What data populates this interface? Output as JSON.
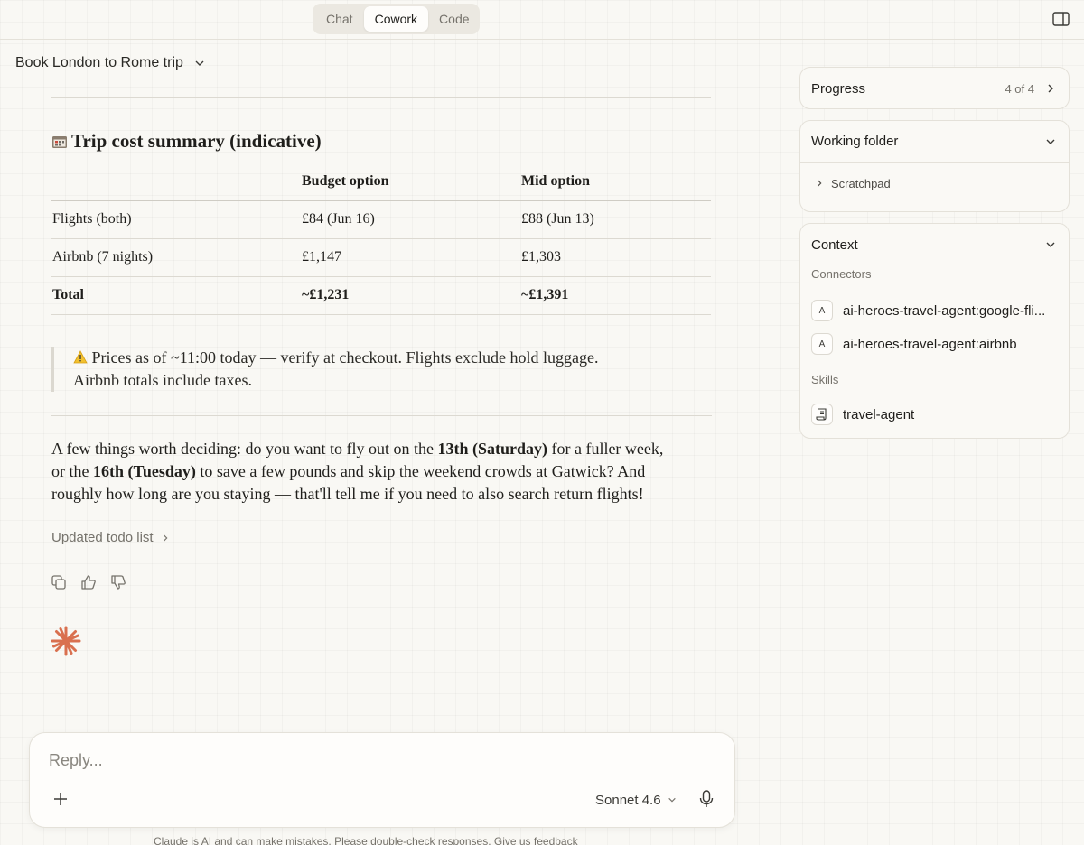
{
  "tabs": [
    {
      "label": "Chat",
      "active": false
    },
    {
      "label": "Cowork",
      "active": true
    },
    {
      "label": "Code",
      "active": false
    }
  ],
  "conversation": {
    "title": "Book London to Rome trip"
  },
  "summary": {
    "title": "Trip cost summary (indicative)",
    "icon": "calendar-icon",
    "headers": [
      "",
      "Budget option",
      "Mid option"
    ],
    "rows": [
      [
        "Flights (both)",
        "£84 (Jun 16)",
        "£88 (Jun 13)"
      ],
      [
        "Airbnb (7 nights)",
        "£1,147",
        "£1,303"
      ],
      [
        "Total",
        "~£1,231",
        "~£1,391"
      ]
    ]
  },
  "note": {
    "icon": "warning-icon",
    "line1": "Prices as of ~11:00 today — verify at checkout. Flights exclude hold luggage.",
    "line2": "Airbnb totals include taxes."
  },
  "message": {
    "p1": "A few things worth deciding: do you want to fly out on the ",
    "b1": "13th (Saturday)",
    "p2": " for a fuller week,",
    "p3": "or the ",
    "b2": "16th (Tuesday)",
    "p4": " to save a few pounds and skip the weekend crowds at Gatwick? And",
    "p5": "roughly how long are you staying — that'll tell me if you need to also search return flights!"
  },
  "todo": {
    "label": "Updated todo list"
  },
  "composer": {
    "placeholder": "Reply...",
    "model": "Sonnet 4.6"
  },
  "disclaimer": "Claude is AI and can make mistakes. Please double-check responses. Give us feedback",
  "panel": {
    "progress": {
      "label": "Progress",
      "count": "4 of 4"
    },
    "folder": {
      "label": "Working folder",
      "item": "Scratchpad"
    },
    "context": {
      "label": "Context",
      "connectors_label": "Connectors",
      "connectors": [
        {
          "badge": "A",
          "name": "ai-heroes-travel-agent:google-fli..."
        },
        {
          "badge": "A",
          "name": "ai-heroes-travel-agent:airbnb"
        }
      ],
      "skills_label": "Skills",
      "skills": [
        {
          "name": "travel-agent",
          "icon": "scroll-icon"
        }
      ]
    }
  },
  "colors": {
    "accent": "#d9704f",
    "text": "#1f1e1b",
    "muted": "#75726b",
    "background": "#f9f8f4"
  }
}
